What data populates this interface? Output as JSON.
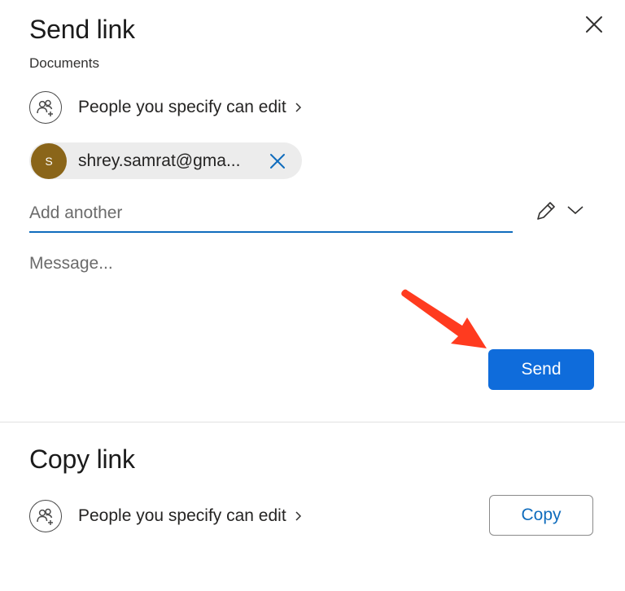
{
  "send_section": {
    "title": "Send link",
    "subtitle": "Documents",
    "permission_label": "People you specify can edit",
    "recipient": {
      "initial": "S",
      "email": "shrey.samrat@gma..."
    },
    "add_placeholder": "Add another",
    "message_placeholder": "Message...",
    "send_label": "Send"
  },
  "copy_section": {
    "title": "Copy link",
    "permission_label": "People you specify can edit",
    "copy_label": "Copy"
  },
  "colors": {
    "primary": "#0f6cdb",
    "avatar": "#8a6519",
    "arrow": "#ff3b1f"
  },
  "icons": {
    "close": "close-icon",
    "people": "people-add-icon",
    "chevron_right": "chevron-right-icon",
    "remove": "remove-recipient-icon",
    "pencil": "pencil-icon",
    "chevron_down": "chevron-down-icon"
  }
}
